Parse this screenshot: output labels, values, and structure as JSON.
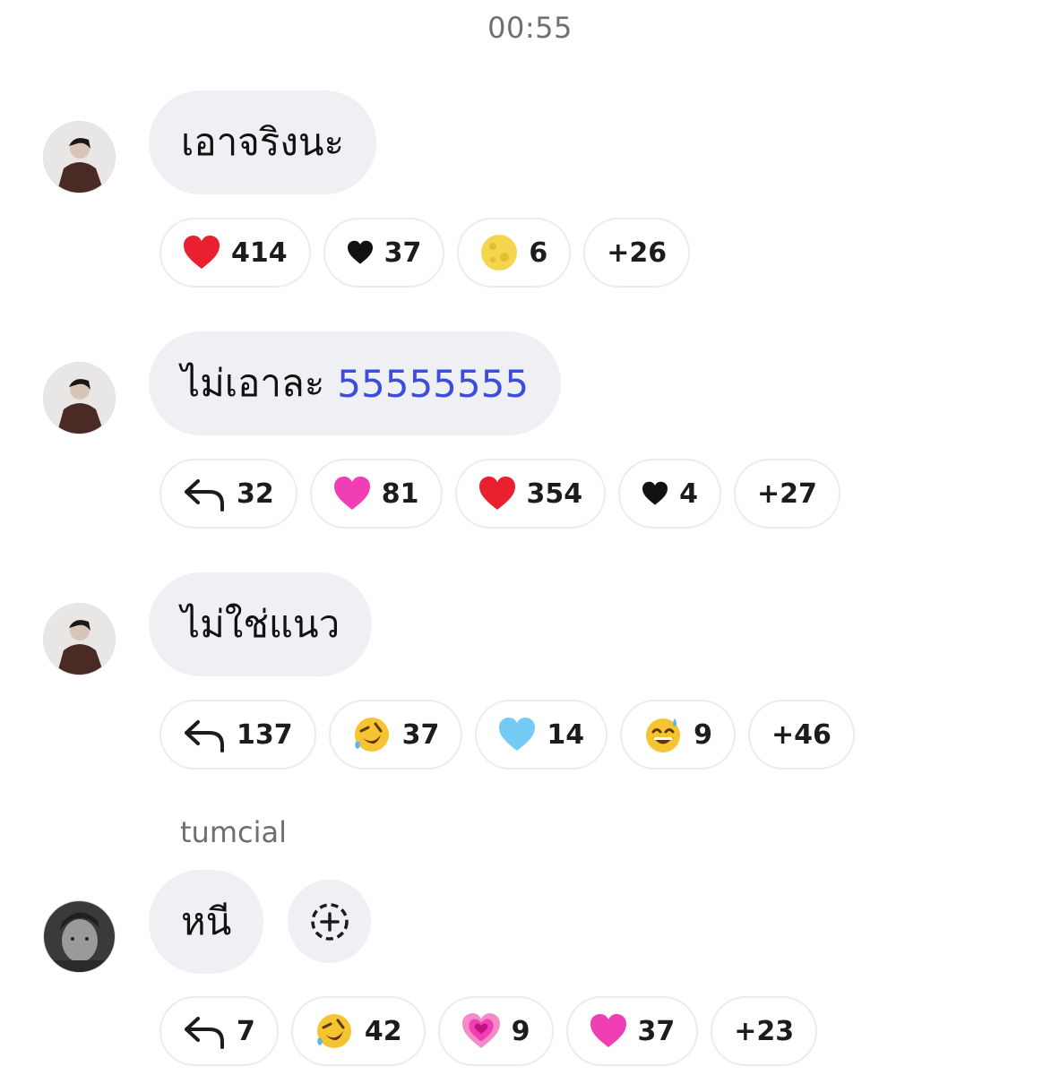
{
  "timestamp": "00:55",
  "messages": [
    {
      "text": "เอาจริงนะ",
      "reactions": [
        {
          "icon": "red-heart-icon",
          "count": "414"
        },
        {
          "icon": "black-heart-icon",
          "count": "37"
        },
        {
          "icon": "full-moon-icon",
          "count": "6"
        },
        {
          "icon": "",
          "count": "+26"
        }
      ]
    },
    {
      "text": "ไม่เอาละ",
      "highlight": "55555555",
      "highlight_color": "#3d4bdf",
      "reactions": [
        {
          "icon": "reply-icon",
          "count": "32"
        },
        {
          "icon": "pink-heart-icon",
          "count": "81"
        },
        {
          "icon": "red-heart-icon",
          "count": "354"
        },
        {
          "icon": "black-heart-icon",
          "count": "4"
        },
        {
          "icon": "",
          "count": "+27"
        }
      ]
    },
    {
      "text": "ไม่ใช่แนว",
      "reactions": [
        {
          "icon": "reply-icon",
          "count": "137"
        },
        {
          "icon": "rofl-icon",
          "count": "37"
        },
        {
          "icon": "light-blue-heart-icon",
          "count": "14"
        },
        {
          "icon": "sweat-smile-icon",
          "count": "9"
        },
        {
          "icon": "",
          "count": "+46"
        }
      ]
    },
    {
      "sender": "tumcial",
      "text": "หนี",
      "reactions": [
        {
          "icon": "reply-icon",
          "count": "7"
        },
        {
          "icon": "rofl-icon",
          "count": "42"
        },
        {
          "icon": "growing-heart-icon",
          "count": "9"
        },
        {
          "icon": "pink-heart-icon",
          "count": "37"
        },
        {
          "icon": "",
          "count": "+23"
        }
      ]
    }
  ]
}
